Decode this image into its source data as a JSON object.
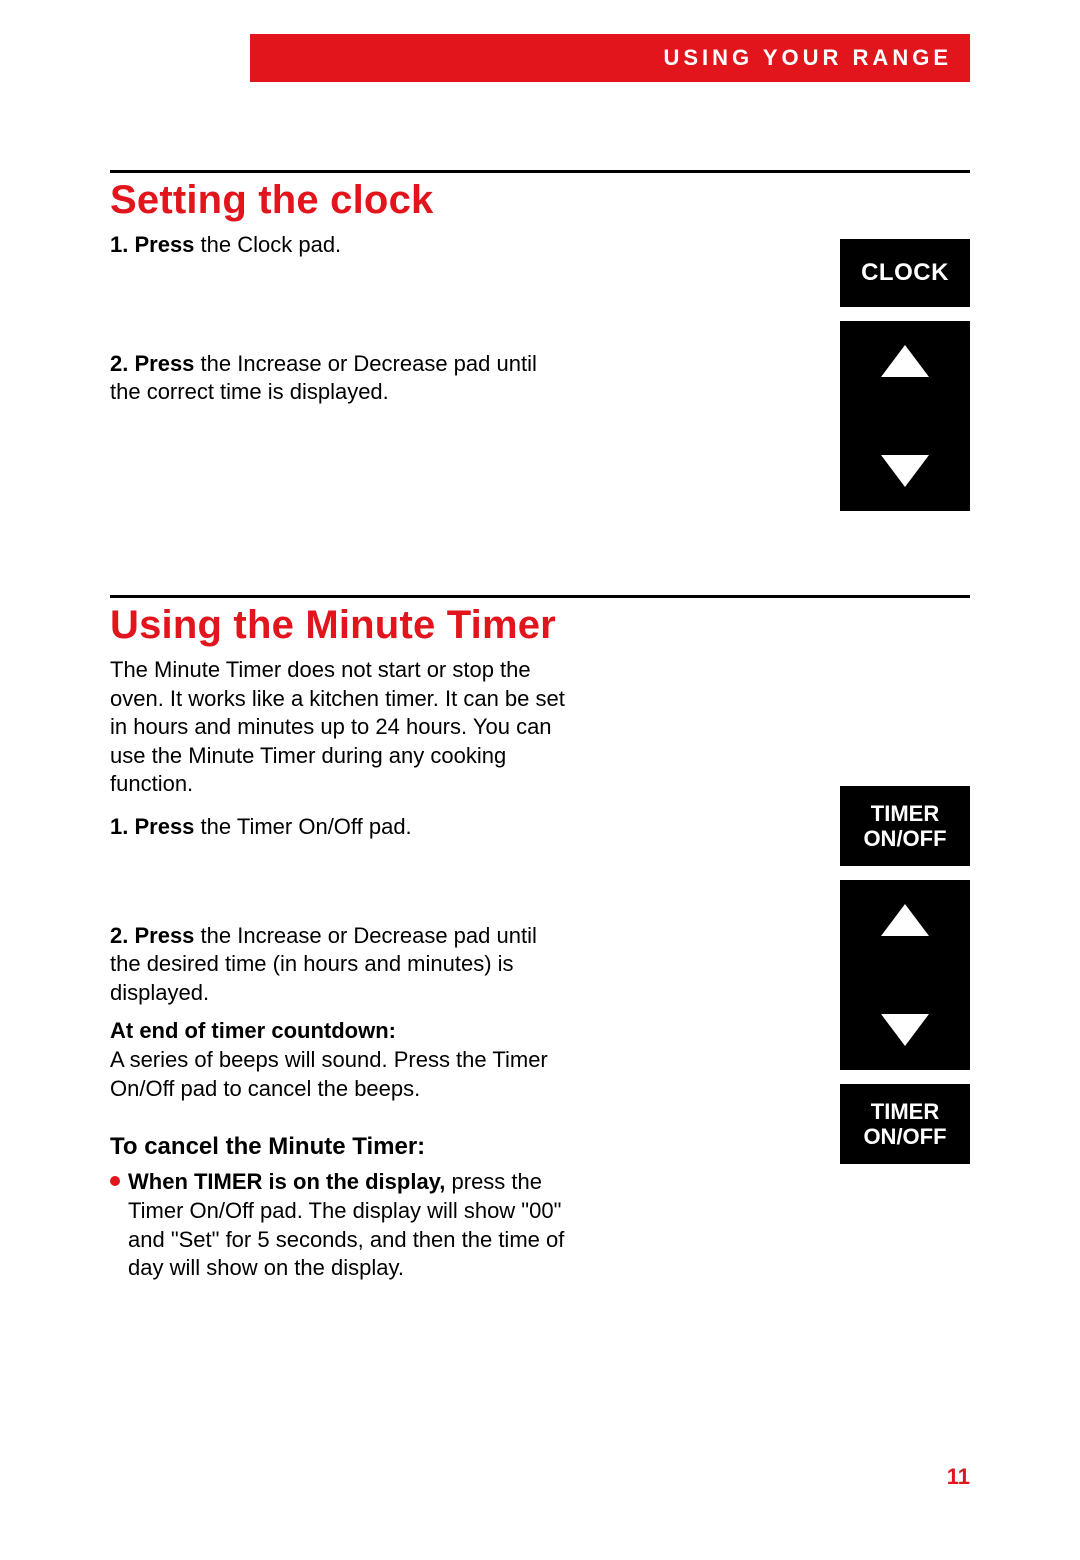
{
  "header": {
    "banner": "USING YOUR RANGE"
  },
  "page_number": "11",
  "section1": {
    "title": "Setting the clock",
    "steps": {
      "s1": {
        "num": "1. ",
        "bold": "Press",
        "rest": " the Clock pad."
      },
      "s2": {
        "num": "2. ",
        "bold": "Press",
        "rest": " the Increase or Decrease pad until the correct time is displayed."
      }
    },
    "pads": {
      "clock": "CLOCK"
    }
  },
  "section2": {
    "title": "Using the Minute Timer",
    "intro": "The Minute Timer does not start or stop the oven. It works like a kitchen timer. It can be set in hours and minutes up to 24 hours. You can use the Minute Timer during any cooking function.",
    "steps": {
      "s1": {
        "num": "1. ",
        "bold": "Press",
        "rest": " the Timer On/Off pad."
      },
      "s2": {
        "num": "2. ",
        "bold": "Press",
        "rest": " the Increase or Decrease pad until the desired time (in hours and minutes) is displayed."
      }
    },
    "countdown_label": "At end of timer countdown:",
    "countdown_text": "A series of beeps will sound. Press the Timer On/Off pad to cancel the beeps.",
    "cancel_heading": "To cancel the Minute Timer:",
    "cancel_bold": "When TIMER is on the display,",
    "cancel_rest": " press the Timer On/Off pad. The display will show \"00\" and \"Set\" for 5 seconds, and then the time of day will show on the display.",
    "pads": {
      "timer_line1": "TIMER",
      "timer_line2": "ON/OFF"
    }
  }
}
